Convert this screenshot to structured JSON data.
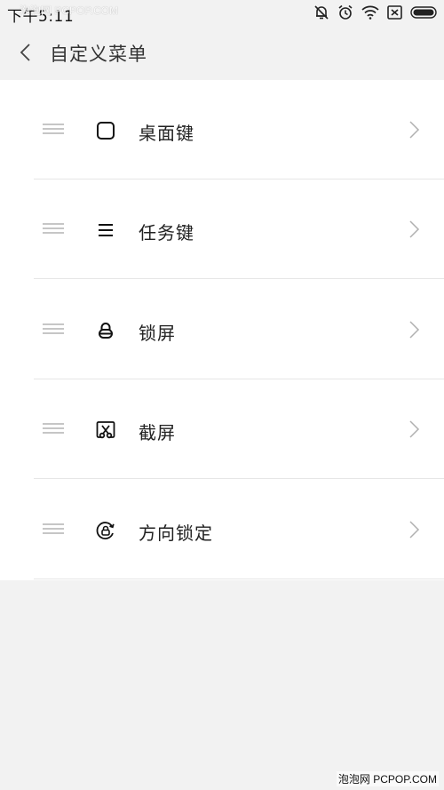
{
  "status_bar": {
    "time": "下午5:11",
    "watermark": "泡泡网 PCPOP.COM",
    "icons": [
      "alarm-off-icon",
      "alarm-clock-icon",
      "wifi-icon",
      "sim-blocked-icon",
      "battery-icon"
    ]
  },
  "header": {
    "back_icon": "chevron-left-icon",
    "title": "自定义菜单"
  },
  "menu_items": [
    {
      "label": "桌面键",
      "icon": "rounded-square-icon"
    },
    {
      "label": "任务键",
      "icon": "menu-lines-icon"
    },
    {
      "label": "锁屏",
      "icon": "padlock-icon"
    },
    {
      "label": "截屏",
      "icon": "screenshot-scissors-icon"
    },
    {
      "label": "方向锁定",
      "icon": "rotation-lock-icon"
    }
  ],
  "footer": {
    "watermark": "泡泡网 PCPOP.COM"
  },
  "colors": {
    "background": "#f2f2f2",
    "list_background": "#ffffff",
    "text": "#222222",
    "divider": "#e6e6e6",
    "handle": "#c6c6c6",
    "chevron": "#b0b0b0"
  }
}
